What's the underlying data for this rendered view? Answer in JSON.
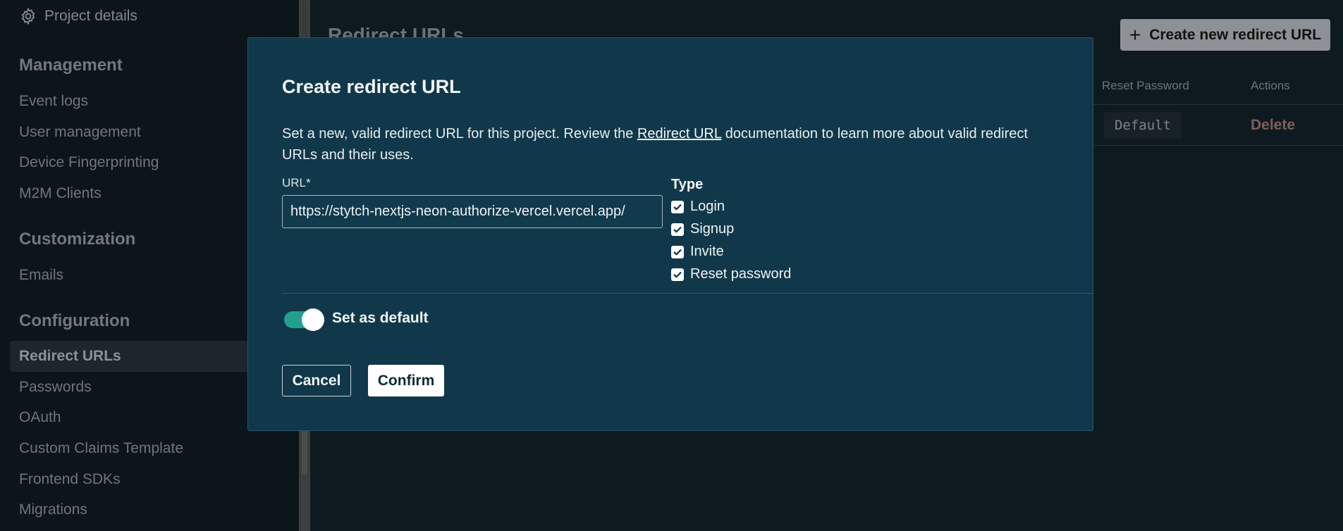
{
  "sidebar": {
    "project_details": "Project details",
    "sections": [
      {
        "heading": "Management",
        "items": [
          "Event logs",
          "User management",
          "Device Fingerprinting",
          "M2M Clients"
        ]
      },
      {
        "heading": "Customization",
        "items": [
          "Emails"
        ]
      },
      {
        "heading": "Configuration",
        "items": [
          "Redirect URLs",
          "Passwords",
          "OAuth",
          "Custom Claims Template",
          "Frontend SDKs",
          "Migrations"
        ]
      }
    ],
    "active_item": "Redirect URLs"
  },
  "main": {
    "title": "Redirect URLs",
    "create_button": "Create new redirect URL",
    "table": {
      "columns": [
        "Reset Password",
        "Actions"
      ],
      "rows": [
        {
          "reset_password": "Default",
          "action": "Delete"
        }
      ]
    }
  },
  "modal": {
    "title": "Create redirect URL",
    "description_before": "Set a new, valid redirect URL for this project. Review the ",
    "description_link": "Redirect URL",
    "description_after": " documentation to learn more about valid redirect URLs and their uses.",
    "url_label": "URL*",
    "url_value": "https://stytch-nextjs-neon-authorize-vercel.vercel.app/",
    "type_label": "Type",
    "type_options": [
      {
        "label": "Login",
        "checked": true
      },
      {
        "label": "Signup",
        "checked": true
      },
      {
        "label": "Invite",
        "checked": true
      },
      {
        "label": "Reset password",
        "checked": true
      }
    ],
    "default_toggle_label": "Set as default",
    "default_toggle_on": true,
    "cancel_label": "Cancel",
    "confirm_label": "Confirm"
  },
  "colors": {
    "modal_bg": "#11384a",
    "toggle_on": "#21a08f",
    "app_bg": "#0f1a20"
  }
}
